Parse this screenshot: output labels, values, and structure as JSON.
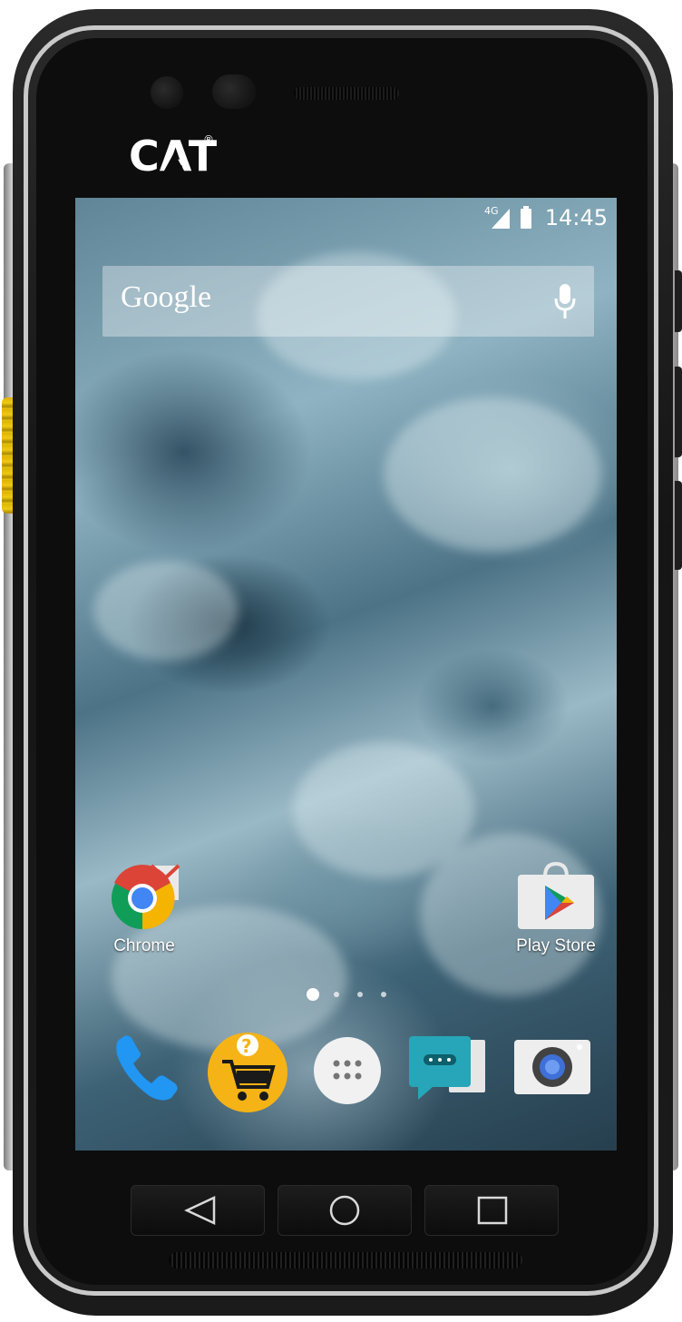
{
  "device": {
    "brand_logo": "CAT",
    "brand_mark": "®"
  },
  "status_bar": {
    "network": "4G",
    "time": "14:45",
    "icons": [
      "signal-icon",
      "battery-icon"
    ]
  },
  "search_widget": {
    "label": "Google",
    "icon": "mic-icon"
  },
  "apps": [
    {
      "label": "Chrome",
      "icon": "chrome-icon"
    },
    {
      "label": "Play Store",
      "icon": "play-store-icon"
    }
  ],
  "page_indicator": {
    "count": 4,
    "active": 1
  },
  "dock": [
    {
      "icon": "phone-icon"
    },
    {
      "icon": "shop-icon"
    },
    {
      "icon": "app-drawer-icon"
    },
    {
      "icon": "messaging-icon"
    },
    {
      "icon": "camera-icon"
    }
  ],
  "nav_buttons": [
    {
      "icon": "back-icon"
    },
    {
      "icon": "home-icon"
    },
    {
      "icon": "recents-icon"
    }
  ],
  "colors": {
    "yellow_key": "#f2c811",
    "chrome_red": "#db4437",
    "chrome_green": "#0f9d58",
    "chrome_yellow": "#f4b400",
    "chrome_blue": "#4285f4",
    "phone_blue": "#2196f3",
    "messaging_teal": "#26a6b8"
  }
}
